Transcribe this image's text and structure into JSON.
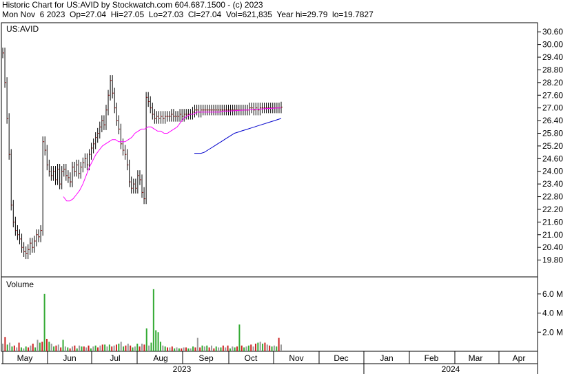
{
  "header": {
    "line1": "Historic Chart for US:AVID by Stockwatch.com 604.687.1500 - (c) 2023",
    "line2": "Mon Nov  6 2023  Op=27.04  Hi=27.05  Lo=27.03  Cl=27.04  Vol=621,835  Year hi=29.79  lo=19.7827"
  },
  "colors": {
    "price_bar": "#8b0000",
    "ma_short": "#ff00ff",
    "ma_long": "#0000cc",
    "vol_up": "#33aa33",
    "vol_down": "#cc2222",
    "vol_flat": "#999999",
    "grid": "#000000"
  },
  "chart_data": [
    {
      "type": "line",
      "title": "US:AVID",
      "ylim": [
        19.2,
        30.9
      ],
      "y_ticks": [
        "30.60",
        "30.00",
        "29.40",
        "28.80",
        "28.20",
        "27.60",
        "27.00",
        "26.40",
        "25.80",
        "25.20",
        "24.60",
        "24.00",
        "23.40",
        "22.80",
        "22.20",
        "21.60",
        "21.00",
        "20.40",
        "19.80"
      ],
      "x_months": [
        "May",
        "Jun",
        "Jul",
        "Aug",
        "Sep",
        "Oct",
        "Nov",
        "Dec",
        "Jan",
        "Feb",
        "Mar",
        "Apr"
      ],
      "x_years": [
        "2023",
        "2024"
      ],
      "ohlc_note": "daily price bars, approx closes",
      "closes": [
        29.6,
        28.2,
        26.5,
        24.8,
        22.4,
        21.6,
        21.2,
        21.0,
        20.8,
        20.4,
        20.2,
        20.1,
        20.3,
        20.6,
        20.4,
        20.7,
        21.0,
        20.9,
        21.2,
        25.4,
        25.0,
        24.3,
        24.0,
        23.8,
        24.0,
        23.6,
        24.1,
        23.4,
        24.0,
        24.1,
        23.8,
        23.7,
        23.5,
        24.2,
        24.0,
        24.3,
        23.9,
        24.2,
        24.4,
        24.6,
        24.3,
        24.8,
        25.1,
        25.3,
        25.6,
        25.8,
        26.1,
        26.4,
        26.2,
        26.9,
        27.6,
        28.3,
        27.7,
        27.0,
        26.4,
        26.0,
        25.3,
        25.0,
        24.8,
        24.3,
        23.5,
        23.2,
        23.4,
        23.2,
        23.8,
        23.6,
        23.0,
        22.7,
        27.5,
        27.3,
        27.0,
        26.7,
        26.5,
        26.6,
        26.5,
        26.6,
        26.5,
        26.6,
        26.6,
        26.6,
        26.7,
        26.6,
        26.6,
        26.6,
        26.7,
        26.6,
        26.7,
        26.7,
        26.7,
        26.7,
        26.8,
        26.9,
        26.9,
        26.8,
        26.9,
        26.9,
        26.9,
        26.9,
        26.9,
        26.9,
        26.9,
        26.9,
        26.9,
        26.9,
        26.9,
        26.9,
        26.9,
        26.9,
        26.9,
        26.9,
        26.9,
        26.9,
        26.9,
        26.9,
        26.9,
        26.9,
        26.9,
        27.0,
        27.0,
        26.9,
        27.0,
        26.9,
        27.0,
        27.0,
        27.0,
        27.0,
        27.0,
        27.0,
        27.0,
        27.0,
        27.0,
        27.0,
        27.04
      ],
      "ma_short": [
        22.8,
        22.6,
        22.6,
        22.7,
        22.9,
        23.1,
        23.4,
        23.8,
        24.2,
        24.5,
        24.8,
        25.0,
        25.2,
        25.3,
        25.4,
        25.5,
        25.5,
        25.4,
        25.4,
        25.4,
        25.5,
        25.6,
        25.8,
        25.9,
        26.0,
        26.0,
        26.1,
        26.1,
        26.0,
        25.9,
        25.9,
        25.8,
        25.8,
        25.9,
        26.0,
        26.1,
        26.3,
        26.5,
        26.6,
        26.7,
        26.7,
        26.8,
        26.8,
        26.8,
        26.8,
        26.8,
        26.8,
        26.8,
        26.8,
        26.85,
        26.85,
        26.85,
        26.86,
        26.87,
        26.88,
        26.89,
        26.9,
        26.9,
        26.92,
        26.93,
        26.94,
        26.95,
        26.96,
        26.97,
        26.98,
        26.99,
        27.0,
        27.0
      ],
      "ma_long": [
        24.85,
        24.85,
        24.85,
        24.9,
        25.0,
        25.1,
        25.2,
        25.3,
        25.4,
        25.5,
        25.6,
        25.7,
        25.8,
        25.85,
        25.9,
        25.95,
        26.0,
        26.05,
        26.1,
        26.15,
        26.2,
        26.25,
        26.3,
        26.35,
        26.4,
        26.45,
        26.5
      ]
    },
    {
      "type": "bar",
      "title": "Volume",
      "y_ticks": [
        "6.0 M",
        "4.0 M",
        "2.0 M"
      ],
      "ylim": [
        0,
        7.5
      ],
      "values": [
        0.8,
        1.5,
        0.7,
        0.9,
        0.5,
        0.6,
        0.4,
        0.9,
        0.4,
        0.3,
        0.5,
        0.4,
        0.6,
        0.8,
        0.4,
        1.2,
        0.9,
        1.0,
        6.0,
        1.3,
        1.0,
        0.8,
        0.5,
        0.6,
        0.7,
        0.4,
        1.2,
        0.5,
        0.4,
        0.3,
        0.5,
        0.6,
        0.3,
        0.6,
        0.5,
        0.5,
        0.4,
        0.6,
        0.3,
        0.5,
        0.6,
        0.4,
        0.6,
        0.7,
        0.7,
        0.5,
        0.7,
        0.5,
        0.6,
        0.7,
        0.8,
        1.0,
        0.5,
        0.6,
        0.8,
        0.6,
        0.4,
        0.5,
        0.8,
        0.5,
        0.8,
        0.7,
        2.4,
        0.6,
        0.9,
        6.5,
        2.2,
        2.0,
        1.0,
        0.6,
        0.5,
        0.4,
        0.4,
        0.5,
        0.3,
        0.4,
        0.3,
        0.3,
        0.4,
        0.4,
        0.3,
        0.3,
        0.5,
        0.4,
        1.4,
        0.4,
        0.6,
        0.5,
        0.6,
        0.4,
        0.6,
        0.3,
        0.5,
        0.4,
        0.4,
        0.6,
        0.4,
        0.6,
        0.3,
        0.5,
        0.4,
        0.5,
        2.8,
        0.6,
        0.4,
        0.5,
        0.6,
        0.7,
        0.5,
        0.8,
        0.9,
        1.0,
        0.8,
        0.9,
        0.7,
        0.6,
        0.5,
        0.6,
        0.5,
        1.4,
        0.7
      ]
    }
  ]
}
